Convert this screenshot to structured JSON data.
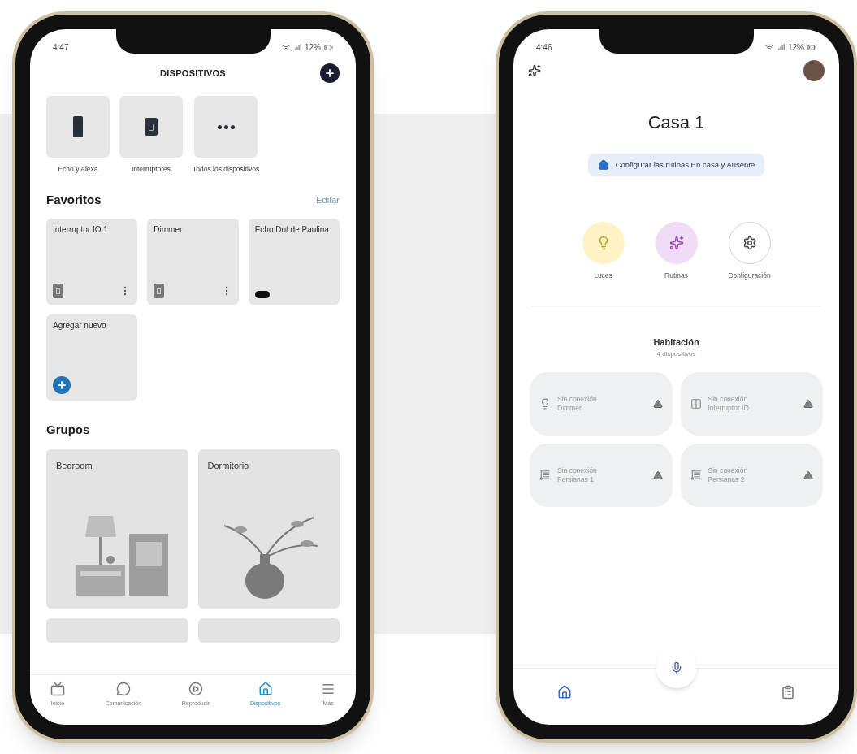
{
  "devices_screen": {
    "status_bar": {
      "time": "4:47",
      "battery": "12%"
    },
    "title": "DISPOSITIVOS",
    "shortcuts": [
      {
        "label": "Echo y Alexa",
        "kind": "echo"
      },
      {
        "label": "Interruptores",
        "kind": "switch"
      },
      {
        "label": "Todos los dispositivos",
        "kind": "more"
      }
    ],
    "favorites": {
      "title": "Favoritos",
      "edit": "Editar",
      "items": [
        {
          "name": "Interruptor IO 1",
          "kind": "switch"
        },
        {
          "name": "Dimmer",
          "kind": "switch"
        },
        {
          "name": "Echo Dot de Paulina",
          "kind": "echo_dot"
        },
        {
          "name": "Agregar nuevo",
          "kind": "add"
        }
      ]
    },
    "groups": {
      "title": "Grupos",
      "items": [
        {
          "name": "Bedroom",
          "kind": "lamp"
        },
        {
          "name": "Dormitorio",
          "kind": "vase"
        }
      ]
    },
    "nav": [
      {
        "label": "Inicio",
        "kind": "home",
        "selected": false
      },
      {
        "label": "Comunicación",
        "kind": "chat",
        "selected": false
      },
      {
        "label": "Reproducir",
        "kind": "play",
        "selected": false
      },
      {
        "label": "Dispositivos",
        "kind": "devices",
        "selected": true
      },
      {
        "label": "Más",
        "kind": "menu",
        "selected": false
      }
    ]
  },
  "home_screen": {
    "status_bar": {
      "time": "4:46",
      "battery": "12%"
    },
    "title": "Casa 1",
    "chip": "Configurar las rutinas En casa y Ausente",
    "actions": [
      {
        "label": "Luces",
        "kind": "lights"
      },
      {
        "label": "Rutinas",
        "kind": "routines"
      },
      {
        "label": "Configuración",
        "kind": "settings"
      }
    ],
    "room": {
      "name": "Habitación",
      "count": "4 dispositivos",
      "devices": [
        {
          "status": "Sin conexión",
          "name": "Dimmer",
          "kind": "bulb"
        },
        {
          "status": "Sin conexión",
          "name": "Interruptor IO",
          "kind": "switch"
        },
        {
          "status": "Sin conexión",
          "name": "Persianas 1",
          "kind": "blinds"
        },
        {
          "status": "Sin conexión",
          "name": "Persianas 2",
          "kind": "blinds"
        }
      ]
    },
    "nav": [
      {
        "kind": "home",
        "selected": true
      },
      {
        "kind": "activity",
        "selected": false
      }
    ]
  }
}
